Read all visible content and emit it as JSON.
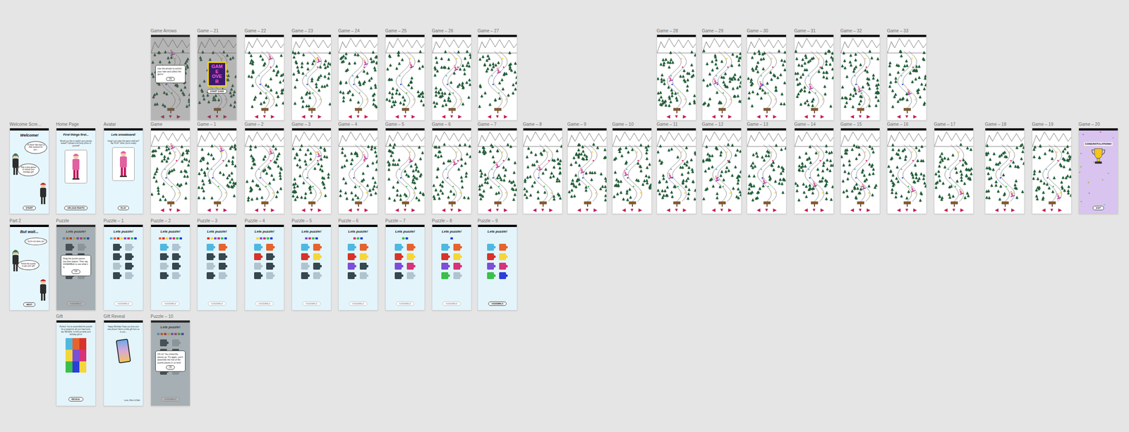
{
  "gem_colors": [
    "#f5d63a",
    "#d6337a",
    "#4fb8e0",
    "#2a3fd6",
    "#3bbf4a"
  ],
  "arrows": [
    "◀",
    "▼",
    "▶"
  ],
  "rows": [
    {
      "frames": [
        {
          "label": "Game Arrows",
          "kind": "game",
          "rider": 0.02,
          "dialog": {
            "text": "Use the arrows to control your rider and collect the gems!",
            "button": "OK"
          }
        },
        {
          "label": "Game – 21",
          "kind": "gameover",
          "rider": 0.3,
          "title": "GAME OVER",
          "button": "START OVER"
        },
        {
          "label": "Game – 22",
          "kind": "game",
          "rider": 0.1
        },
        {
          "label": "Game – 23",
          "kind": "game",
          "rider": 0.15
        },
        {
          "label": "Game – 24",
          "kind": "game",
          "rider": 0.2
        },
        {
          "label": "Game – 25",
          "kind": "game",
          "rider": 0.25
        },
        {
          "label": "Game – 26",
          "kind": "game",
          "rider": 0.3
        },
        {
          "label": "Game – 27",
          "kind": "game",
          "rider": 0.35
        },
        {
          "label": "Game – 28",
          "kind": "game",
          "rider": 0.5
        },
        {
          "label": "Game – 29",
          "kind": "game",
          "rider": 0.55
        },
        {
          "label": "Game – 30",
          "kind": "game",
          "rider": 0.6
        },
        {
          "label": "Game – 31",
          "kind": "game",
          "rider": 0.65
        },
        {
          "label": "Game – 32",
          "kind": "game",
          "rider": 0.7
        },
        {
          "label": "Game – 33",
          "kind": "game",
          "rider": 0.75
        }
      ]
    },
    {
      "frames": [
        {
          "label": "Welcome Scre...",
          "kind": "intro",
          "title": "Welcome!",
          "bubbles": [
            "Hi there! We have a little surprise for you...",
            "Play a few games to unlock your birthday gift!"
          ],
          "button": "START"
        },
        {
          "label": "Home Page",
          "kind": "profile",
          "title": "First things first...",
          "body": "Would you like to switch your pseudo avatar? Upload a full body photo of yourself!",
          "button": "UPLOAD PHOTO"
        },
        {
          "label": "Avatar",
          "kind": "profile",
          "title": "Lets snowboard!",
          "body": "Great! Let's play this game shall we? Tap 'PLAY' when you're ready!",
          "button": "PLAY"
        },
        {
          "label": "Game",
          "kind": "game",
          "rider": 0.02
        },
        {
          "label": "Game – 1",
          "kind": "game",
          "rider": 0.07
        },
        {
          "label": "Game – 2",
          "kind": "game",
          "rider": 0.12
        },
        {
          "label": "Game – 3",
          "kind": "game",
          "rider": 0.17
        },
        {
          "label": "Game – 4",
          "kind": "game",
          "rider": 0.22
        },
        {
          "label": "Game – 5",
          "kind": "game",
          "rider": 0.27
        },
        {
          "label": "Game – 6",
          "kind": "game",
          "rider": 0.32
        },
        {
          "label": "Game – 7",
          "kind": "game",
          "rider": 0.37
        },
        {
          "label": "Game – 8",
          "kind": "game",
          "rider": 0.42
        },
        {
          "label": "Game – 9",
          "kind": "game",
          "rider": 0.47
        },
        {
          "label": "Game – 10",
          "kind": "game",
          "rider": 0.52
        },
        {
          "label": "Game – 11",
          "kind": "game",
          "rider": 0.57
        },
        {
          "label": "Game – 12",
          "kind": "game",
          "rider": 0.62
        },
        {
          "label": "Game – 13",
          "kind": "game",
          "rider": 0.67
        },
        {
          "label": "Game – 14",
          "kind": "game",
          "rider": 0.72
        },
        {
          "label": "Game – 15",
          "kind": "game",
          "rider": 0.77
        },
        {
          "label": "Game – 16",
          "kind": "game",
          "rider": 0.82
        },
        {
          "label": "Game – 17",
          "kind": "game",
          "rider": 0.87
        },
        {
          "label": "Game – 18",
          "kind": "game",
          "rider": 0.91
        },
        {
          "label": "Game – 19",
          "kind": "game",
          "rider": 0.95
        },
        {
          "label": "Game – 20",
          "kind": "win",
          "title": "CONGRATULATIONS!",
          "button": "EXIT"
        }
      ]
    },
    {
      "frames": [
        {
          "label": "Part 2",
          "kind": "intro",
          "title": "But wait...",
          "bubbles": [
            "You're not done yet!",
            "Finish the puzzle to get your gift!"
          ],
          "button": "NEXT"
        },
        {
          "label": "Puzzle",
          "kind": "puzzle",
          "title": "Lets puzzle!",
          "button": "ASSEMBLE",
          "disabled": true,
          "dialog": {
            "text": "Drag the puzzle pieces into their places. Then tap ASSEMBLE to see what it is.",
            "button": "OK"
          },
          "pieces": [
            {
              "color": "#4fb8e0",
              "placed": false
            },
            {
              "color": "#e8622c",
              "placed": false
            },
            {
              "color": "#d8332b",
              "placed": false
            },
            {
              "color": "#f5d63a",
              "placed": false
            },
            {
              "color": "#7b4fd6",
              "placed": false
            },
            {
              "color": "#d6337a",
              "placed": false
            },
            {
              "color": "#3bbf4a",
              "placed": false
            },
            {
              "color": "#2a3fd6",
              "placed": false
            }
          ]
        },
        {
          "label": "Puzzle – 1",
          "kind": "puzzle",
          "title": "Lets puzzle!",
          "button": "ASSEMBLE",
          "disabled": true,
          "pieces": [
            {
              "color": "#4fb8e0",
              "placed": false
            },
            {
              "color": "#e8622c",
              "placed": false
            },
            {
              "color": "#d8332b",
              "placed": false
            },
            {
              "color": "#f5d63a",
              "placed": false
            },
            {
              "color": "#7b4fd6",
              "placed": false
            },
            {
              "color": "#d6337a",
              "placed": false
            },
            {
              "color": "#3bbf4a",
              "placed": false
            },
            {
              "color": "#2a3fd6",
              "placed": false
            }
          ]
        },
        {
          "label": "Puzzle – 2",
          "kind": "puzzle",
          "title": "Lets puzzle!",
          "button": "ASSEMBLE",
          "disabled": true,
          "pieces": [
            {
              "color": "#4fb8e0",
              "placed": true
            },
            {
              "color": "#e8622c",
              "placed": false
            },
            {
              "color": "#d8332b",
              "placed": false
            },
            {
              "color": "#f5d63a",
              "placed": false
            },
            {
              "color": "#7b4fd6",
              "placed": false
            },
            {
              "color": "#d6337a",
              "placed": false
            },
            {
              "color": "#3bbf4a",
              "placed": false
            },
            {
              "color": "#2a3fd6",
              "placed": false
            }
          ]
        },
        {
          "label": "Puzzle – 3",
          "kind": "puzzle",
          "title": "Lets puzzle!",
          "button": "ASSEMBLE",
          "disabled": true,
          "pieces": [
            {
              "color": "#4fb8e0",
              "placed": true
            },
            {
              "color": "#e8622c",
              "placed": true
            },
            {
              "color": "#d8332b",
              "placed": false
            },
            {
              "color": "#f5d63a",
              "placed": false
            },
            {
              "color": "#7b4fd6",
              "placed": false
            },
            {
              "color": "#d6337a",
              "placed": false
            },
            {
              "color": "#3bbf4a",
              "placed": false
            },
            {
              "color": "#2a3fd6",
              "placed": false
            }
          ]
        },
        {
          "label": "Puzzle – 4",
          "kind": "puzzle",
          "title": "Lets puzzle!",
          "button": "ASSEMBLE",
          "disabled": true,
          "pieces": [
            {
              "color": "#4fb8e0",
              "placed": true
            },
            {
              "color": "#e8622c",
              "placed": true
            },
            {
              "color": "#d8332b",
              "placed": true
            },
            {
              "color": "#f5d63a",
              "placed": false
            },
            {
              "color": "#7b4fd6",
              "placed": false
            },
            {
              "color": "#d6337a",
              "placed": false
            },
            {
              "color": "#3bbf4a",
              "placed": false
            },
            {
              "color": "#2a3fd6",
              "placed": false
            }
          ]
        },
        {
          "label": "Puzzle – 5",
          "kind": "puzzle",
          "title": "Lets puzzle!",
          "button": "ASSEMBLE",
          "disabled": true,
          "pieces": [
            {
              "color": "#4fb8e0",
              "placed": true
            },
            {
              "color": "#e8622c",
              "placed": true
            },
            {
              "color": "#d8332b",
              "placed": true
            },
            {
              "color": "#f5d63a",
              "placed": true
            },
            {
              "color": "#7b4fd6",
              "placed": false
            },
            {
              "color": "#d6337a",
              "placed": false
            },
            {
              "color": "#3bbf4a",
              "placed": false
            },
            {
              "color": "#2a3fd6",
              "placed": false
            }
          ]
        },
        {
          "label": "Puzzle – 6",
          "kind": "puzzle",
          "title": "Lets puzzle!",
          "button": "ASSEMBLE",
          "disabled": true,
          "pieces": [
            {
              "color": "#4fb8e0",
              "placed": true
            },
            {
              "color": "#e8622c",
              "placed": true
            },
            {
              "color": "#d8332b",
              "placed": true
            },
            {
              "color": "#f5d63a",
              "placed": true
            },
            {
              "color": "#7b4fd6",
              "placed": true
            },
            {
              "color": "#d6337a",
              "placed": false
            },
            {
              "color": "#3bbf4a",
              "placed": false
            },
            {
              "color": "#2a3fd6",
              "placed": false
            }
          ]
        },
        {
          "label": "Puzzle – 7",
          "kind": "puzzle",
          "title": "Lets puzzle!",
          "button": "ASSEMBLE",
          "disabled": true,
          "pieces": [
            {
              "color": "#4fb8e0",
              "placed": true
            },
            {
              "color": "#e8622c",
              "placed": true
            },
            {
              "color": "#d8332b",
              "placed": true
            },
            {
              "color": "#f5d63a",
              "placed": true
            },
            {
              "color": "#7b4fd6",
              "placed": true
            },
            {
              "color": "#d6337a",
              "placed": true
            },
            {
              "color": "#3bbf4a",
              "placed": false
            },
            {
              "color": "#2a3fd6",
              "placed": false
            }
          ]
        },
        {
          "label": "Puzzle – 8",
          "kind": "puzzle",
          "title": "Lets puzzle!",
          "button": "ASSEMBLE",
          "disabled": true,
          "pieces": [
            {
              "color": "#4fb8e0",
              "placed": true
            },
            {
              "color": "#e8622c",
              "placed": true
            },
            {
              "color": "#d8332b",
              "placed": true
            },
            {
              "color": "#f5d63a",
              "placed": true
            },
            {
              "color": "#7b4fd6",
              "placed": true
            },
            {
              "color": "#d6337a",
              "placed": true
            },
            {
              "color": "#3bbf4a",
              "placed": true
            },
            {
              "color": "#2a3fd6",
              "placed": false
            }
          ]
        },
        {
          "label": "Puzzle – 9",
          "kind": "puzzle",
          "title": "Lets puzzle!",
          "button": "ASSEMBLE",
          "disabled": false,
          "pieces": [
            {
              "color": "#4fb8e0",
              "placed": true
            },
            {
              "color": "#e8622c",
              "placed": true
            },
            {
              "color": "#d8332b",
              "placed": true
            },
            {
              "color": "#f5d63a",
              "placed": true
            },
            {
              "color": "#7b4fd6",
              "placed": true
            },
            {
              "color": "#d6337a",
              "placed": true
            },
            {
              "color": "#3bbf4a",
              "placed": true
            },
            {
              "color": "#2a3fd6",
              "placed": true
            }
          ]
        }
      ]
    },
    {
      "frames": [
        {
          "label": "Gift",
          "kind": "gift",
          "text": "Perfect! You've assembled the puzzle! As a reward for all your hard work, tap 'REVEAL' to find out what your birthday gift is!",
          "button": "REVEAL",
          "colors": [
            "#4fb8e0",
            "#e8622c",
            "#d8332b",
            "#f5d63a",
            "#7b4fd6",
            "#d6337a",
            "#3bbf4a",
            "#2a3fd6",
            "#f5d63a"
          ]
        },
        {
          "label": "Gift Reveal",
          "kind": "reveal",
          "text": "Happy Birthday! Hope you love your new phone! Here's a little gift from us to you...",
          "sign": "Love, Mom & Dad"
        },
        {
          "label": "Puzzle – 10",
          "kind": "puzzle",
          "title": "Lets puzzle!",
          "button": "ASSEMBLE",
          "disabled": true,
          "dialog": {
            "text": "Oh no! You mixed the pieces up. Try again, you'll assemble the rest of the puzzle pieces in no time!",
            "button": "OK"
          },
          "pieces": [
            {
              "color": "#4fb8e0",
              "placed": false
            },
            {
              "color": "#e8622c",
              "placed": false
            },
            {
              "color": "#d8332b",
              "placed": false
            },
            {
              "color": "#f5d63a",
              "placed": false
            },
            {
              "color": "#7b4fd6",
              "placed": false
            },
            {
              "color": "#d6337a",
              "placed": false
            },
            {
              "color": "#3bbf4a",
              "placed": false
            },
            {
              "color": "#2a3fd6",
              "placed": false
            }
          ]
        }
      ]
    }
  ]
}
